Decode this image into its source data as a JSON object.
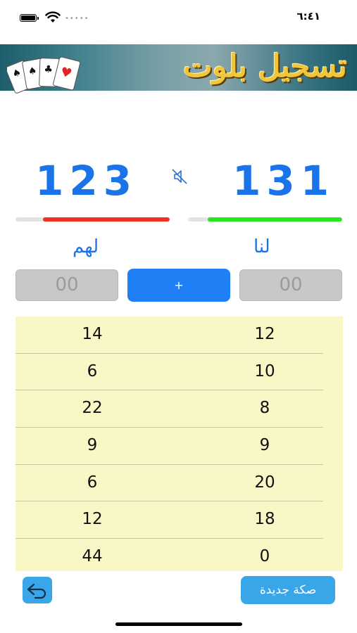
{
  "status_bar": {
    "time": "٦:٤١",
    "signal": "•••••"
  },
  "banner": {
    "title": "تسجيل بلوت"
  },
  "scores": {
    "them": {
      "total": "123",
      "progress": 0.82,
      "color": "#f03024",
      "label": "لهم",
      "input_placeholder": "00"
    },
    "us": {
      "total": "131",
      "progress": 0.87,
      "color": "#27e81f",
      "label": "لنا",
      "input_placeholder": "00"
    }
  },
  "add_button_label": "+",
  "rounds": [
    {
      "them": "14",
      "us": "12"
    },
    {
      "them": "6",
      "us": "10"
    },
    {
      "them": "22",
      "us": "8"
    },
    {
      "them": "9",
      "us": "9"
    },
    {
      "them": "6",
      "us": "20"
    },
    {
      "them": "12",
      "us": "18"
    },
    {
      "them": "44",
      "us": "0"
    }
  ],
  "footer": {
    "new_game_label": "صكة جديدة"
  },
  "icons": {
    "mute": "speaker-muted-icon",
    "undo": "undo-arrow-icon",
    "wifi": "wifi-icon",
    "battery": "battery-icon"
  },
  "colors": {
    "accent": "#1a73e8",
    "button": "#1f7ff5",
    "table_bg": "#f9f7c6",
    "footer_button": "#38a6e8"
  }
}
